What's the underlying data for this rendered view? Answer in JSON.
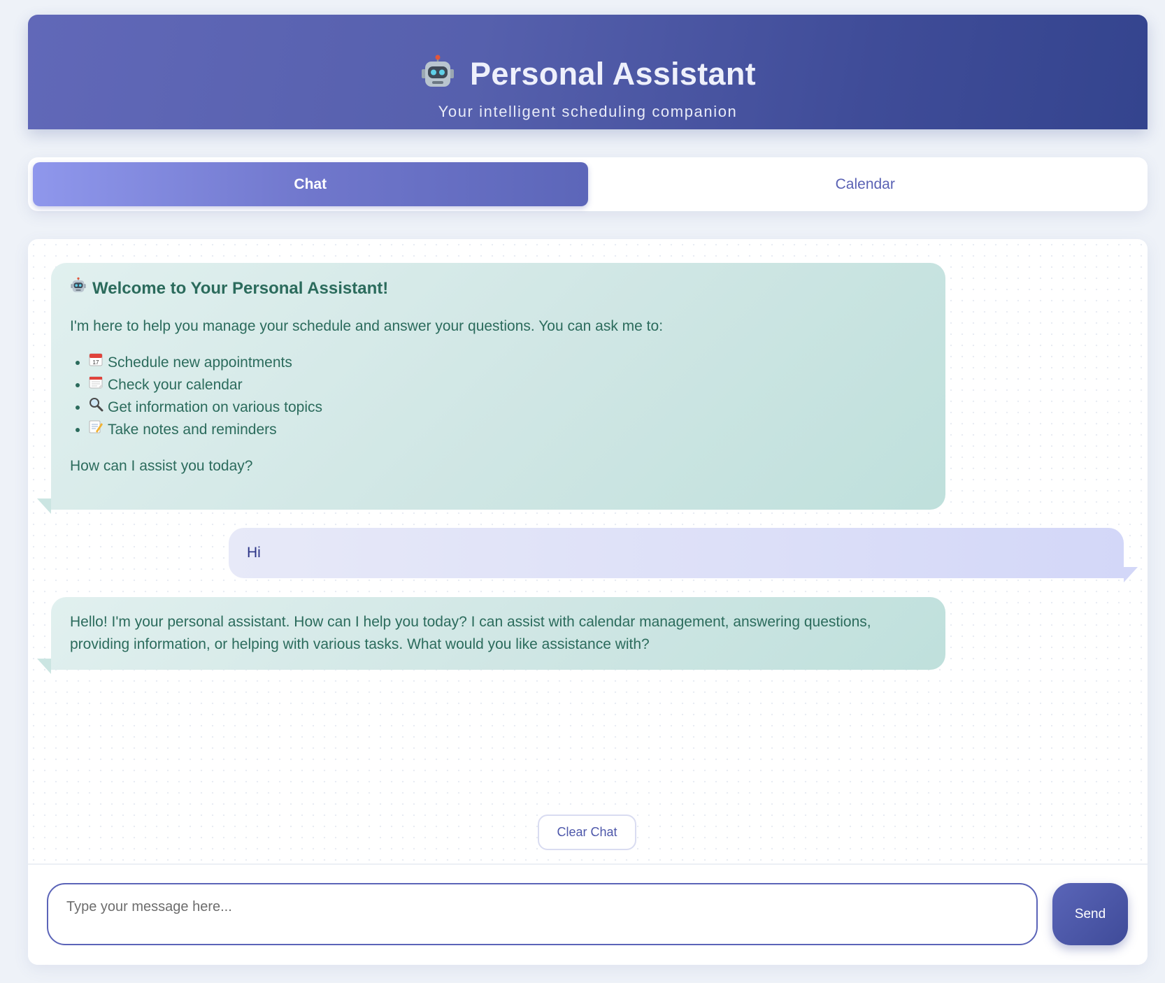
{
  "header": {
    "icon": "robot-icon",
    "title": "Personal Assistant",
    "subtitle": "Your intelligent scheduling companion"
  },
  "tabs": [
    {
      "label": "Chat",
      "active": true
    },
    {
      "label": "Calendar",
      "active": false
    }
  ],
  "chat": {
    "messages": [
      {
        "role": "assistant",
        "heading_icon": "robot-icon",
        "heading": "Welcome to Your Personal Assistant!",
        "intro": "I'm here to help you manage your schedule and answer your questions. You can ask me to:",
        "items": [
          {
            "icon": "calendar-icon",
            "text": "Schedule new appointments"
          },
          {
            "icon": "spiral-calendar-icon",
            "text": "Check your calendar"
          },
          {
            "icon": "magnifier-icon",
            "text": "Get information on various topics"
          },
          {
            "icon": "memo-icon",
            "text": "Take notes and reminders"
          }
        ],
        "closing": "How can I assist you today?"
      },
      {
        "role": "user",
        "text": "Hi"
      },
      {
        "role": "assistant",
        "text": "Hello! I'm your personal assistant. How can I help you today? I can assist with calendar management, answering questions, providing information, or helping with various tasks. What would you like assistance with?"
      }
    ],
    "clear_label": "Clear Chat"
  },
  "input": {
    "placeholder": "Type your message here...",
    "value": "",
    "send_label": "Send"
  },
  "colors": {
    "header_start": "#6168b8",
    "header_end": "#34448e",
    "assistant_bubble": "#cfe6e4",
    "assistant_text": "#2b6b5c",
    "user_bubble": "#dcdff8",
    "user_text": "#2c3487",
    "accent": "#5b64b8"
  }
}
